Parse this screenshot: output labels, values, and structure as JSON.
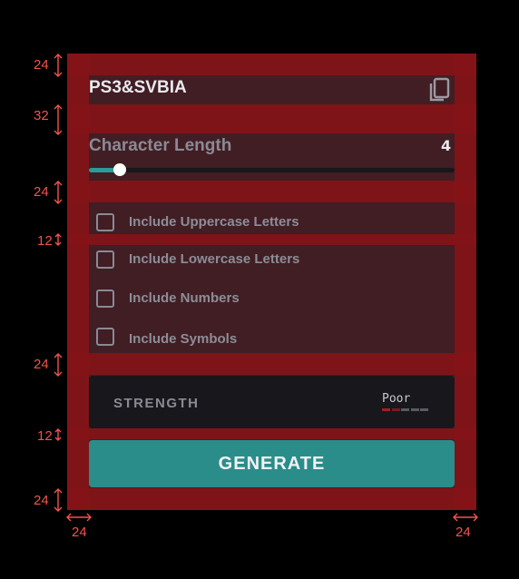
{
  "password": "PS3&SVBIA",
  "character_length": {
    "label": "Character Length",
    "value": "4",
    "fraction": 0.085
  },
  "options": [
    {
      "label": "Include Uppercase Letters",
      "checked": false
    },
    {
      "label": "Include Lowercase Letters",
      "checked": false
    },
    {
      "label": "Include Numbers",
      "checked": false
    },
    {
      "label": "Include Symbols",
      "checked": false
    }
  ],
  "strength": {
    "label": "STRENGTH",
    "value": "Poor",
    "level": 1,
    "max": 5
  },
  "generate_label": "GENERATE",
  "spacing_labels": {
    "top": "24",
    "gap_header": "32",
    "gap_length": "24",
    "gap_option": "12",
    "gap_strength": "24",
    "gap_generate": "12",
    "bottom": "24",
    "left": "24",
    "right": "24"
  },
  "colors": {
    "accent": "#2a8d8a",
    "overlay": "#8b1418",
    "poor": "#a81d21"
  },
  "icons": {
    "copy": "copy-icon",
    "checkbox": "checkbox-icon"
  }
}
